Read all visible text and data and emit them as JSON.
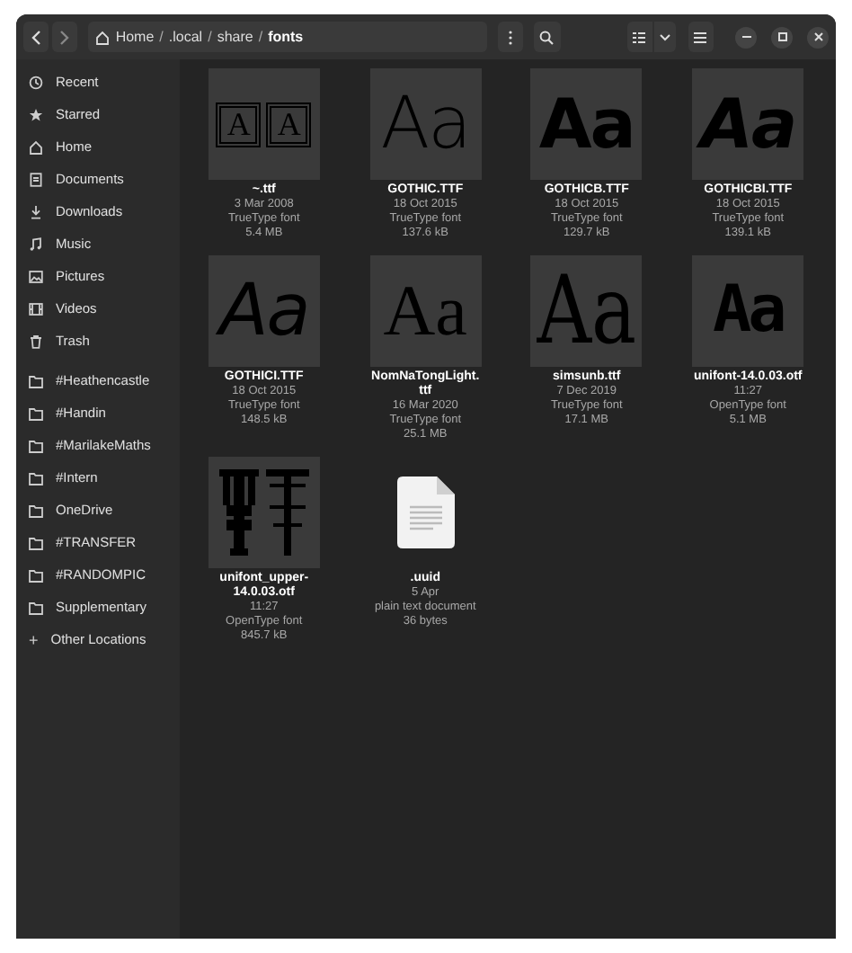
{
  "path_bar": {
    "segments": [
      {
        "label": "Home",
        "selected": false
      },
      {
        "label": ".local",
        "selected": false
      },
      {
        "label": "share",
        "selected": false
      },
      {
        "label": "fonts",
        "selected": true
      }
    ],
    "separator": "/"
  },
  "sidebar": {
    "places": [
      {
        "label": "Recent"
      },
      {
        "label": "Starred"
      },
      {
        "label": "Home"
      },
      {
        "label": "Documents"
      },
      {
        "label": "Downloads"
      },
      {
        "label": "Music"
      },
      {
        "label": "Pictures"
      },
      {
        "label": "Videos"
      },
      {
        "label": "Trash"
      }
    ],
    "bookmarks": [
      {
        "label": "#Heathencastle"
      },
      {
        "label": "#Handin"
      },
      {
        "label": "#MarilakeMaths"
      },
      {
        "label": "#Intern"
      },
      {
        "label": "OneDrive"
      },
      {
        "label": "#TRANSFER"
      },
      {
        "label": "#RANDOMPIC"
      },
      {
        "label": "Supplementary"
      }
    ],
    "other": {
      "label": "Other Locations",
      "icon": "+"
    }
  },
  "files": [
    {
      "name": "~.ttf",
      "date": "3 Mar 2008",
      "type": "TrueType font",
      "size": "5.4 MB",
      "kind": "boxed",
      "preview": "A A"
    },
    {
      "name": "GOTHIC.TTF",
      "date": "18 Oct 2015",
      "type": "TrueType font",
      "size": "137.6 kB",
      "kind": "light",
      "preview": "Aa"
    },
    {
      "name": "GOTHICB.TTF",
      "date": "18 Oct 2015",
      "type": "TrueType font",
      "size": "129.7 kB",
      "kind": "black",
      "preview": "Aa"
    },
    {
      "name": "GOTHICBI.TTF",
      "date": "18 Oct 2015",
      "type": "TrueType font",
      "size": "139.1 kB",
      "kind": "black-italic",
      "preview": "Aa"
    },
    {
      "name": "GOTHICI.TTF",
      "date": "18 Oct 2015",
      "type": "TrueType font",
      "size": "148.5 kB",
      "kind": "italic",
      "preview": "Aa"
    },
    {
      "name": "NomNaTongLight.\nttf",
      "date": "16 Mar 2020",
      "type": "TrueType font",
      "size": "25.1 MB",
      "kind": "serif",
      "preview": "Aa"
    },
    {
      "name": "simsunb.ttf",
      "date": "7 Dec 2019",
      "type": "TrueType font",
      "size": "17.1 MB",
      "kind": "serif-light",
      "preview": "Aa"
    },
    {
      "name": "unifont-14.0.03.otf",
      "date": "11:27",
      "type": "OpenType font",
      "size": "5.1 MB",
      "kind": "pixel",
      "preview": "Aa"
    },
    {
      "name": "unifont_upper-\n14.0.03.otf",
      "date": "11:27",
      "type": "OpenType font",
      "size": "845.7 kB",
      "kind": "glyph-art"
    },
    {
      "name": ".uuid",
      "date": "5 Apr",
      "type": "plain text document",
      "size": "36 bytes",
      "kind": "document"
    }
  ]
}
